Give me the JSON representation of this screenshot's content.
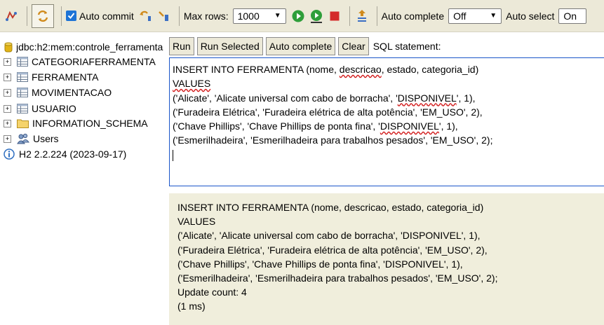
{
  "toolbar": {
    "auto_commit_label": "Auto commit",
    "max_rows_label": "Max rows:",
    "max_rows_value": "1000",
    "auto_complete_label": "Auto complete",
    "auto_complete_value": "Off",
    "auto_select_label": "Auto select",
    "auto_select_value": "On"
  },
  "tree": {
    "connection": "jdbc:h2:mem:controle_ferramentas",
    "items": [
      {
        "label": "CATEGORIAFERRAMENTA",
        "icon": "table-icon"
      },
      {
        "label": "FERRAMENTA",
        "icon": "table-icon"
      },
      {
        "label": "MOVIMENTACAO",
        "icon": "table-icon"
      },
      {
        "label": "USUARIO",
        "icon": "table-icon"
      },
      {
        "label": "INFORMATION_SCHEMA",
        "icon": "folder-icon"
      },
      {
        "label": "Users",
        "icon": "users-icon"
      }
    ],
    "version": "H2 2.2.224 (2023-09-17)"
  },
  "buttons": {
    "run": "Run",
    "run_selected": "Run Selected",
    "auto_complete": "Auto complete",
    "clear": "Clear",
    "sql_label": "SQL statement:"
  },
  "editor": {
    "l1_a": "INSERT INTO FERRAMENTA (nome, ",
    "l1_b": "descricao",
    "l1_c": ", estado, categoria_id)",
    "l2": "VALUES",
    "l3_a": "('Alicate', 'Alicate universal com cabo de borracha', '",
    "l3_b": "DISPONIVEL",
    "l3_c": "', 1),",
    "l4": "('Furadeira Elétrica', 'Furadeira elétrica de alta potência', 'EM_USO', 2),",
    "l5_a": "('Chave Phillips', 'Chave Phillips de ponta fina', '",
    "l5_b": "DISPONIVEL",
    "l5_c": "', 1),",
    "l6": "('Esmerilhadeira', 'Esmerilhadeira para trabalhos pesados', 'EM_USO', 2);"
  },
  "result": {
    "lines": [
      "INSERT INTO FERRAMENTA (nome, descricao, estado, categoria_id)",
      "VALUES",
      "('Alicate', 'Alicate universal com cabo de borracha', 'DISPONIVEL', 1),",
      "('Furadeira Elétrica', 'Furadeira elétrica de alta potência', 'EM_USO', 2),",
      "('Chave Phillips', 'Chave Phillips de ponta fina', 'DISPONIVEL', 1),",
      "('Esmerilhadeira', 'Esmerilhadeira para trabalhos pesados', 'EM_USO', 2);",
      "Update count: 4",
      "(1 ms)"
    ]
  },
  "colors": {
    "toolbar_bg": "#ece9d8",
    "editor_border": "#1a56c9",
    "result_bg": "#f0eedc",
    "run_green": "#2e9e3a",
    "stop_red": "#d42a2a"
  }
}
